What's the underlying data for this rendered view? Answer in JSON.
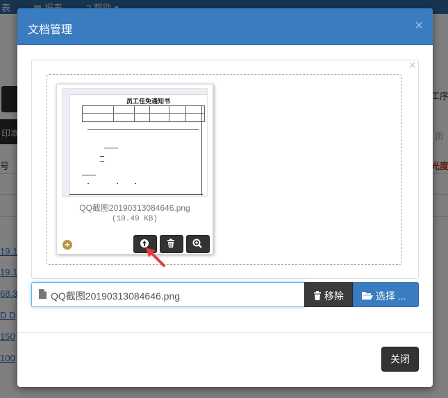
{
  "background": {
    "topbar_items": [
      "表",
      "报表",
      "帮助"
    ],
    "right_texts": [
      "工序",
      "页",
      "光度"
    ],
    "left_texts": [
      "印本",
      "号"
    ],
    "links": [
      "19.1",
      "19.1",
      "68.3",
      "D D",
      "150",
      "100"
    ]
  },
  "modal": {
    "title": "文档管理",
    "close_symbol": "×",
    "preview": {
      "doc_title": "员工任免通知书",
      "file_name": "QQ截图20190313084646.png",
      "file_size": "(10.49 KB)"
    },
    "caption": {
      "file_name": "QQ截图20190313084646.png"
    },
    "buttons": {
      "remove_label": "移除",
      "browse_label": "选择 ...",
      "close_label": "关闭"
    },
    "colors": {
      "header": "#3a7cc0",
      "dark_button": "#333333",
      "arrow": "#e8393c"
    }
  }
}
